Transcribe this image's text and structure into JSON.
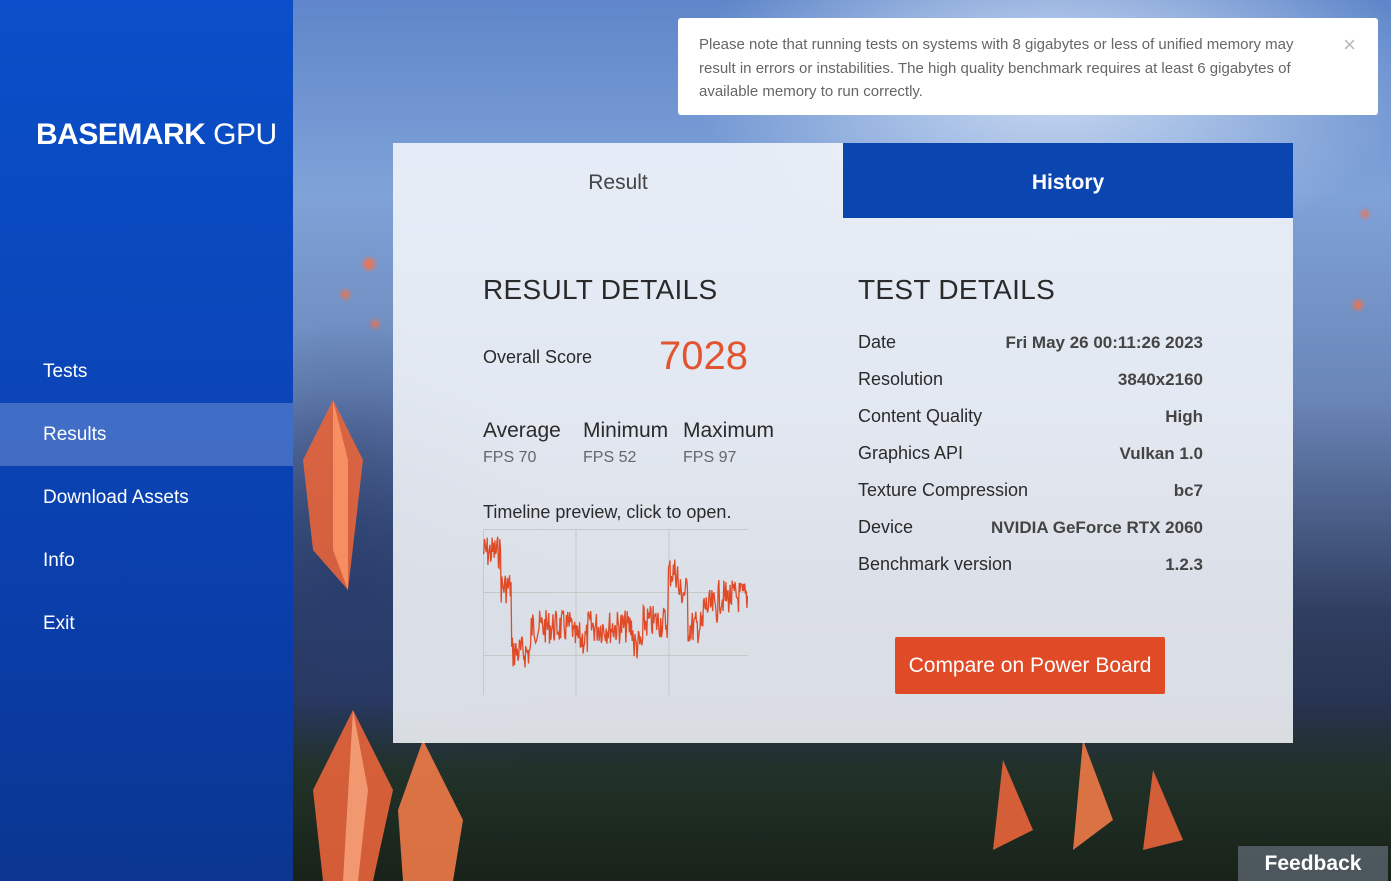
{
  "sidebar": {
    "logo_brand": "BASEMARK",
    "logo_suffix": " GPU",
    "items": [
      {
        "label": "Tests"
      },
      {
        "label": "Results"
      },
      {
        "label": "Download Assets"
      },
      {
        "label": "Info"
      },
      {
        "label": "Exit"
      }
    ],
    "active_index": 1
  },
  "notice": {
    "text": "Please note that running tests on systems with 8 gigabytes or less of unified memory may result in errors or instabilities. The high quality benchmark requires at least 6 gigabytes of available memory to run correctly.",
    "close_glyph": "×"
  },
  "tabs": {
    "result": "Result",
    "history": "History",
    "active": "result"
  },
  "result_details": {
    "title": "RESULT DETAILS",
    "overall_label": "Overall Score",
    "overall_value": "7028",
    "stats": [
      {
        "name": "Average",
        "value": "FPS 70"
      },
      {
        "name": "Minimum",
        "value": "FPS 52"
      },
      {
        "name": "Maximum",
        "value": "FPS 97"
      }
    ],
    "timeline_label": "Timeline preview, click to open."
  },
  "test_details": {
    "title": "TEST DETAILS",
    "rows": [
      {
        "key": "Date",
        "value": "Fri May 26 00:11:26 2023"
      },
      {
        "key": "Resolution",
        "value": "3840x2160"
      },
      {
        "key": "Content Quality",
        "value": "High"
      },
      {
        "key": "Graphics API",
        "value": "Vulkan 1.0"
      },
      {
        "key": "Texture Compression",
        "value": "bc7"
      },
      {
        "key": "Device",
        "value": "NVIDIA GeForce RTX 2060"
      },
      {
        "key": "Benchmark version",
        "value": "1.2.3"
      }
    ]
  },
  "compare_button": "Compare on Power Board",
  "feedback_button": "Feedback",
  "colors": {
    "accent_orange": "#e04a26",
    "sidebar_blue": "#0a4fc9",
    "history_tab_blue": "#0b45b0",
    "score_color": "#e25430",
    "timeline_line": "#e04a26"
  }
}
